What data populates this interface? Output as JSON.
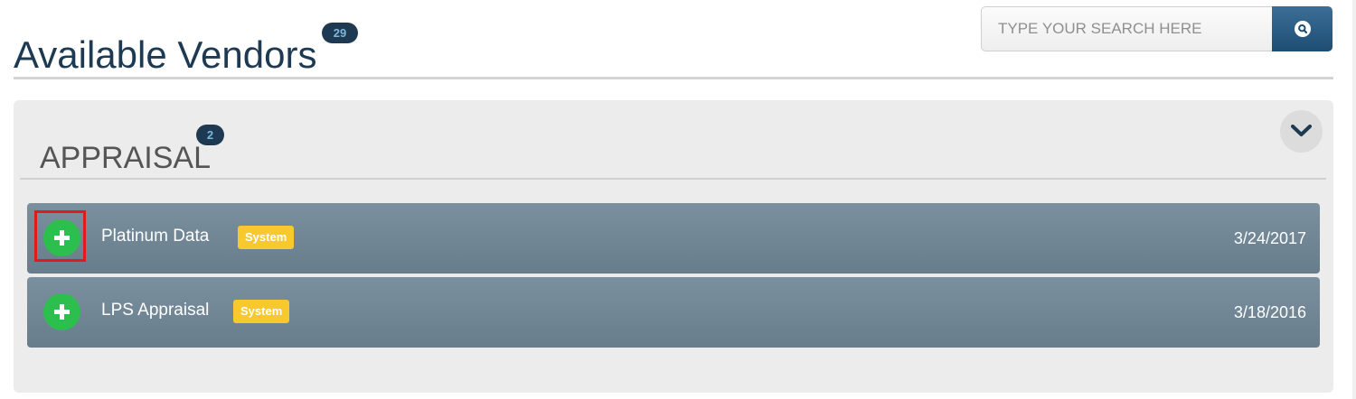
{
  "header": {
    "title": "Available Vendors",
    "count": "29"
  },
  "search": {
    "placeholder": "TYPE YOUR SEARCH HERE",
    "value": "",
    "button_icon": "search-icon"
  },
  "category": {
    "title": "APPRAISAL",
    "count": "2",
    "toggle_icon": "chevron-down-icon",
    "vendors": [
      {
        "name": "Platinum Data",
        "tag": "System",
        "date": "3/24/2017",
        "action_icon": "plus-icon",
        "highlighted": true
      },
      {
        "name": "LPS Appraisal",
        "tag": "System",
        "date": "3/18/2016",
        "action_icon": "plus-icon",
        "highlighted": false
      }
    ]
  },
  "colors": {
    "title": "#1e3a52",
    "badge_bg": "#1e3a52",
    "badge_text": "#7fb6dc",
    "search_button": "#2a5a80",
    "row_bg": "#71869a",
    "add_button": "#2dbf4e",
    "tag_bg": "#f7c92d",
    "highlight": "#e01b1b"
  }
}
